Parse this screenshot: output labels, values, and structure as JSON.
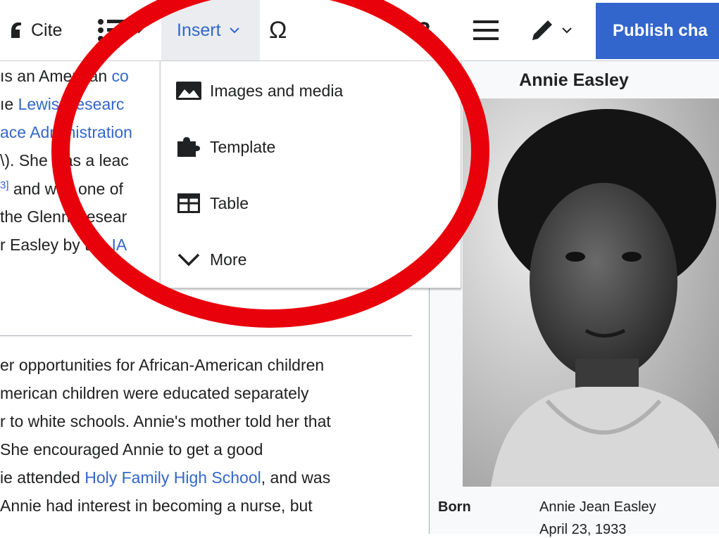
{
  "toolbar": {
    "cite_label": "Cite",
    "insert_label": "Insert",
    "special_char": "Ω",
    "help_glyph": "?",
    "publish_label": "Publish cha"
  },
  "menu": {
    "items": [
      {
        "label": "Images and media",
        "icon": "image-icon"
      },
      {
        "label": "Template",
        "icon": "puzzle-icon"
      },
      {
        "label": "Table",
        "icon": "table-icon"
      },
      {
        "label": "More",
        "icon": "chevron-down-icon"
      }
    ]
  },
  "article": {
    "l1a": "ıs an American ",
    "l1b": "co",
    "l2a": "ıe ",
    "l2b": "Lewis Researc",
    "l3": "ace Administration",
    "l4": "\\). She was a leac",
    "l5sup": "3]",
    "l5": " and was one of",
    "l6": "the Glenn Resear",
    "l7a": "r Easley by the ",
    "l7b": "IA",
    "p1": "er opportunities for African-American children",
    "p2": "merican children were educated separately",
    "p3": "r to white schools. Annie's mother told her that",
    "p4": " She encouraged Annie to get a good",
    "p5a": "ie attended ",
    "p5b": "Holy Family High School",
    "p5c": ", and was",
    "p6": "Annie had interest in becoming a nurse, but"
  },
  "infobox": {
    "title": "Annie Easley",
    "born_label": "Born",
    "born_name": "Annie Jean Easley",
    "born_date": "April 23, 1933"
  },
  "colors": {
    "accent": "#3366cc",
    "annotation": "#e8000b"
  }
}
